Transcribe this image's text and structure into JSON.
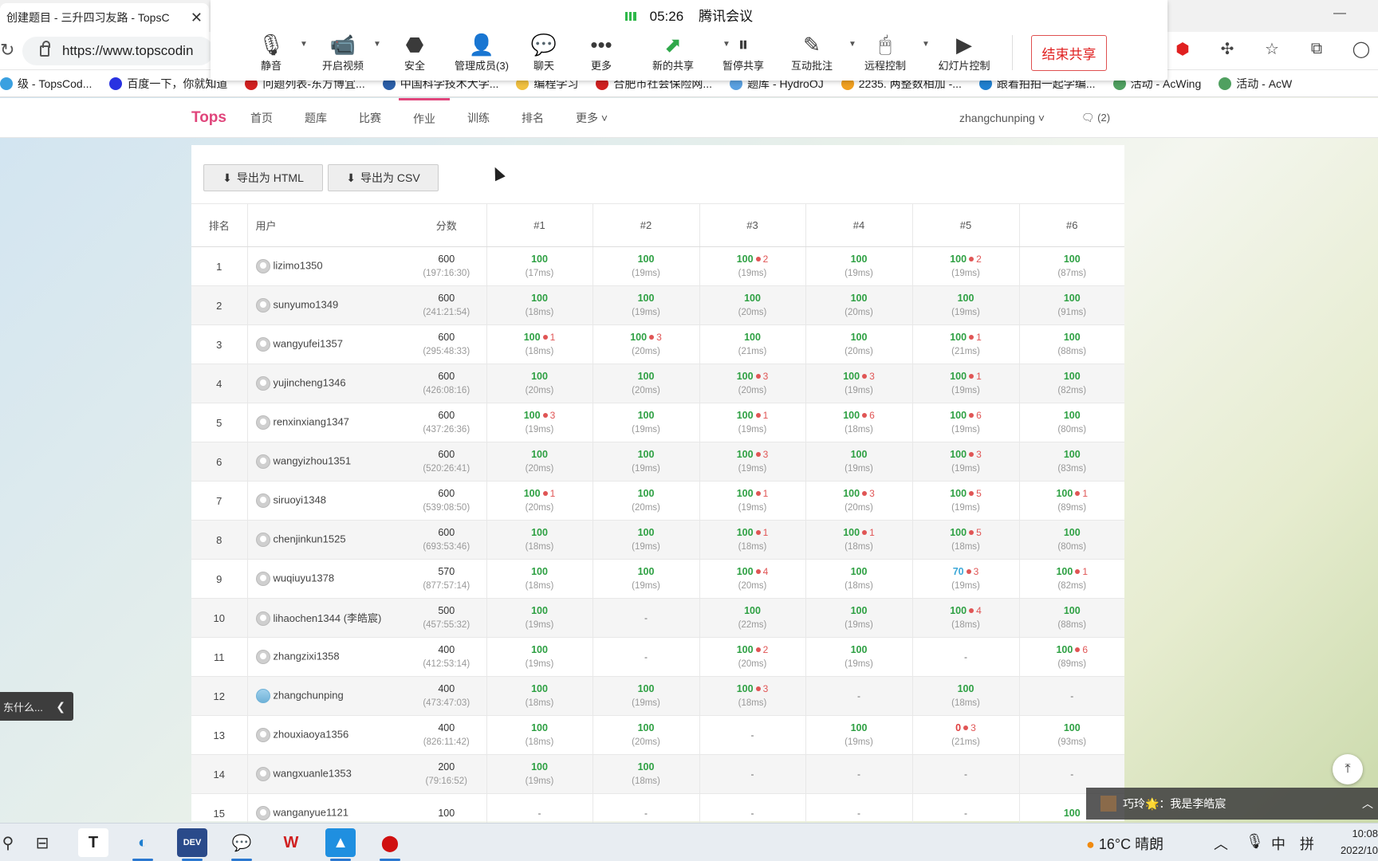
{
  "browser": {
    "tab_title": "创建题目 - 三升四习友路 - TopsC",
    "url": "https://www.topscodin",
    "bookmarks": [
      {
        "label": "级 - TopsCod...",
        "color": "#3aa0e0"
      },
      {
        "label": "百度一下，你就知道",
        "color": "#2932e1"
      },
      {
        "label": "问题列表-东方博宜...",
        "color": "#d32020"
      },
      {
        "label": "中国科学技术大学...",
        "color": "#2b5fa8"
      },
      {
        "label": "编程学习",
        "color": "#f0c040"
      },
      {
        "label": "合肥市社会保险网...",
        "color": "#d02020"
      },
      {
        "label": "题库 - HydroOJ",
        "color": "#5aa0e0"
      },
      {
        "label": "2235. 两整数相加 -...",
        "color": "#f0a020"
      },
      {
        "label": "跟着拍拍一起学编...",
        "color": "#2080d0"
      },
      {
        "label": "活动 - AcWing",
        "color": "#50a060"
      },
      {
        "label": "活动 - AcW",
        "color": "#50a060"
      }
    ]
  },
  "meeting": {
    "time": "05:26",
    "app_name": "腾讯会议",
    "buttons": {
      "mute": "静音",
      "video": "开启视频",
      "security": "安全",
      "members": "管理成员(3)",
      "chat": "聊天",
      "more": "更多",
      "new_share": "新的共享",
      "pause_share": "暂停共享",
      "annotate": "互动批注",
      "remote": "远程控制",
      "slides": "幻灯片控制"
    },
    "end_share": "结束共享"
  },
  "site": {
    "logo": "Tops",
    "nav": [
      "首页",
      "题库",
      "比赛",
      "作业",
      "训练",
      "排名",
      "更多 ˅"
    ],
    "active_nav": "作业",
    "user": "zhangchunping ˅",
    "messages": "(2)"
  },
  "exports": {
    "html": "导出为 HTML",
    "csv": "导出为 CSV"
  },
  "table": {
    "headers": {
      "rank": "排名",
      "user": "用户",
      "score": "分数",
      "p1": "#1",
      "p2": "#2",
      "p3": "#3",
      "p4": "#4",
      "p5": "#5",
      "p6": "#6"
    },
    "rows": [
      {
        "rank": "1",
        "user": "lizimo1350",
        "avatar": "default",
        "score": "600",
        "time": "(197:16:30)",
        "p": [
          {
            "s": "100",
            "t": "(17ms)"
          },
          {
            "s": "100",
            "t": "(19ms)"
          },
          {
            "s": "100",
            "e": "2",
            "t": "(19ms)"
          },
          {
            "s": "100",
            "t": "(19ms)"
          },
          {
            "s": "100",
            "e": "2",
            "t": "(19ms)"
          },
          {
            "s": "100",
            "t": "(87ms)"
          }
        ]
      },
      {
        "rank": "2",
        "user": "sunyumo1349",
        "avatar": "default",
        "score": "600",
        "time": "(241:21:54)",
        "p": [
          {
            "s": "100",
            "t": "(18ms)"
          },
          {
            "s": "100",
            "t": "(19ms)"
          },
          {
            "s": "100",
            "t": "(20ms)"
          },
          {
            "s": "100",
            "t": "(20ms)"
          },
          {
            "s": "100",
            "t": "(19ms)"
          },
          {
            "s": "100",
            "t": "(91ms)"
          }
        ]
      },
      {
        "rank": "3",
        "user": "wangyufei1357",
        "avatar": "default",
        "score": "600",
        "time": "(295:48:33)",
        "p": [
          {
            "s": "100",
            "e": "1",
            "t": "(18ms)"
          },
          {
            "s": "100",
            "e": "3",
            "t": "(20ms)"
          },
          {
            "s": "100",
            "t": "(21ms)"
          },
          {
            "s": "100",
            "t": "(20ms)"
          },
          {
            "s": "100",
            "e": "1",
            "t": "(21ms)"
          },
          {
            "s": "100",
            "t": "(88ms)"
          }
        ]
      },
      {
        "rank": "4",
        "user": "yujincheng1346",
        "avatar": "default",
        "score": "600",
        "time": "(426:08:16)",
        "p": [
          {
            "s": "100",
            "t": "(20ms)"
          },
          {
            "s": "100",
            "t": "(20ms)"
          },
          {
            "s": "100",
            "e": "3",
            "t": "(20ms)"
          },
          {
            "s": "100",
            "e": "3",
            "t": "(19ms)"
          },
          {
            "s": "100",
            "e": "1",
            "t": "(19ms)"
          },
          {
            "s": "100",
            "t": "(82ms)"
          }
        ]
      },
      {
        "rank": "5",
        "user": "renxinxiang1347",
        "avatar": "default",
        "score": "600",
        "time": "(437:26:36)",
        "p": [
          {
            "s": "100",
            "e": "3",
            "t": "(19ms)"
          },
          {
            "s": "100",
            "t": "(19ms)"
          },
          {
            "s": "100",
            "e": "1",
            "t": "(19ms)"
          },
          {
            "s": "100",
            "e": "6",
            "t": "(18ms)"
          },
          {
            "s": "100",
            "e": "6",
            "t": "(19ms)"
          },
          {
            "s": "100",
            "t": "(80ms)"
          }
        ]
      },
      {
        "rank": "6",
        "user": "wangyizhou1351",
        "avatar": "default",
        "score": "600",
        "time": "(520:26:41)",
        "p": [
          {
            "s": "100",
            "t": "(20ms)"
          },
          {
            "s": "100",
            "t": "(19ms)"
          },
          {
            "s": "100",
            "e": "3",
            "t": "(19ms)"
          },
          {
            "s": "100",
            "t": "(19ms)"
          },
          {
            "s": "100",
            "e": "3",
            "t": "(19ms)"
          },
          {
            "s": "100",
            "t": "(83ms)"
          }
        ]
      },
      {
        "rank": "7",
        "user": "siruoyi1348",
        "avatar": "default",
        "score": "600",
        "time": "(539:08:50)",
        "p": [
          {
            "s": "100",
            "e": "1",
            "t": "(20ms)"
          },
          {
            "s": "100",
            "t": "(20ms)"
          },
          {
            "s": "100",
            "e": "1",
            "t": "(19ms)"
          },
          {
            "s": "100",
            "e": "3",
            "t": "(20ms)"
          },
          {
            "s": "100",
            "e": "5",
            "t": "(19ms)"
          },
          {
            "s": "100",
            "e": "1",
            "t": "(89ms)"
          }
        ]
      },
      {
        "rank": "8",
        "user": "chenjinkun1525",
        "avatar": "default",
        "score": "600",
        "time": "(693:53:46)",
        "p": [
          {
            "s": "100",
            "t": "(18ms)"
          },
          {
            "s": "100",
            "t": "(19ms)"
          },
          {
            "s": "100",
            "e": "1",
            "t": "(18ms)"
          },
          {
            "s": "100",
            "e": "1",
            "t": "(18ms)"
          },
          {
            "s": "100",
            "e": "5",
            "t": "(18ms)"
          },
          {
            "s": "100",
            "t": "(80ms)"
          }
        ]
      },
      {
        "rank": "9",
        "user": "wuqiuyu1378",
        "avatar": "default",
        "score": "570",
        "time": "(877:57:14)",
        "p": [
          {
            "s": "100",
            "t": "(18ms)"
          },
          {
            "s": "100",
            "t": "(19ms)"
          },
          {
            "s": "100",
            "e": "4",
            "t": "(20ms)"
          },
          {
            "s": "100",
            "t": "(18ms)"
          },
          {
            "s": "70",
            "e": "3",
            "t": "(19ms)"
          },
          {
            "s": "100",
            "e": "1",
            "t": "(82ms)"
          }
        ]
      },
      {
        "rank": "10",
        "user": "lihaochen1344 (李皓宸)",
        "avatar": "default",
        "score": "500",
        "time": "(457:55:32)",
        "p": [
          {
            "s": "100",
            "t": "(19ms)"
          },
          {
            "s": "-"
          },
          {
            "s": "100",
            "t": "(22ms)"
          },
          {
            "s": "100",
            "t": "(19ms)"
          },
          {
            "s": "100",
            "e": "4",
            "t": "(18ms)"
          },
          {
            "s": "100",
            "t": "(88ms)"
          }
        ]
      },
      {
        "rank": "11",
        "user": "zhangzixi1358",
        "avatar": "default",
        "score": "400",
        "time": "(412:53:14)",
        "p": [
          {
            "s": "100",
            "t": "(19ms)"
          },
          {
            "s": "-"
          },
          {
            "s": "100",
            "e": "2",
            "t": "(20ms)"
          },
          {
            "s": "100",
            "t": "(19ms)"
          },
          {
            "s": "-"
          },
          {
            "s": "100",
            "e": "6",
            "t": "(89ms)"
          }
        ]
      },
      {
        "rank": "12",
        "user": "zhangchunping",
        "avatar": "photo",
        "score": "400",
        "time": "(473:47:03)",
        "p": [
          {
            "s": "100",
            "t": "(18ms)"
          },
          {
            "s": "100",
            "t": "(19ms)"
          },
          {
            "s": "100",
            "e": "3",
            "t": "(18ms)"
          },
          {
            "s": "-"
          },
          {
            "s": "100",
            "t": "(18ms)"
          },
          {
            "s": "-"
          }
        ]
      },
      {
        "rank": "13",
        "user": "zhouxiaoya1356",
        "avatar": "default",
        "score": "400",
        "time": "(826:11:42)",
        "p": [
          {
            "s": "100",
            "t": "(18ms)"
          },
          {
            "s": "100",
            "t": "(20ms)"
          },
          {
            "s": "-"
          },
          {
            "s": "100",
            "t": "(19ms)"
          },
          {
            "s": "0",
            "e": "3",
            "t": "(21ms)"
          },
          {
            "s": "100",
            "t": "(93ms)"
          }
        ]
      },
      {
        "rank": "14",
        "user": "wangxuanle1353",
        "avatar": "default",
        "score": "200",
        "time": "(79:16:52)",
        "p": [
          {
            "s": "100",
            "t": "(19ms)"
          },
          {
            "s": "100",
            "t": "(18ms)"
          },
          {
            "s": "-"
          },
          {
            "s": "-"
          },
          {
            "s": "-"
          },
          {
            "s": "-"
          }
        ]
      },
      {
        "rank": "15",
        "user": "wanganyue1121",
        "avatar": "default",
        "score": "100",
        "time": "",
        "p": [
          {
            "s": "-"
          },
          {
            "s": "-"
          },
          {
            "s": "-"
          },
          {
            "s": "-"
          },
          {
            "s": "-"
          },
          {
            "s": "100"
          }
        ]
      }
    ]
  },
  "overlays": {
    "side_popup": "东什么...",
    "chat_sender": "巧玲🌟：我是李皓宸"
  },
  "taskbar": {
    "weather": "16°C  晴朗",
    "ime": "中",
    "ime2": "拼",
    "time": "10:08",
    "date": "2022/10"
  },
  "colors": {
    "accent": "#e0457b",
    "ac_green": "#2ea043",
    "error_red": "#e04040",
    "partial_blue": "#3da8d8"
  }
}
